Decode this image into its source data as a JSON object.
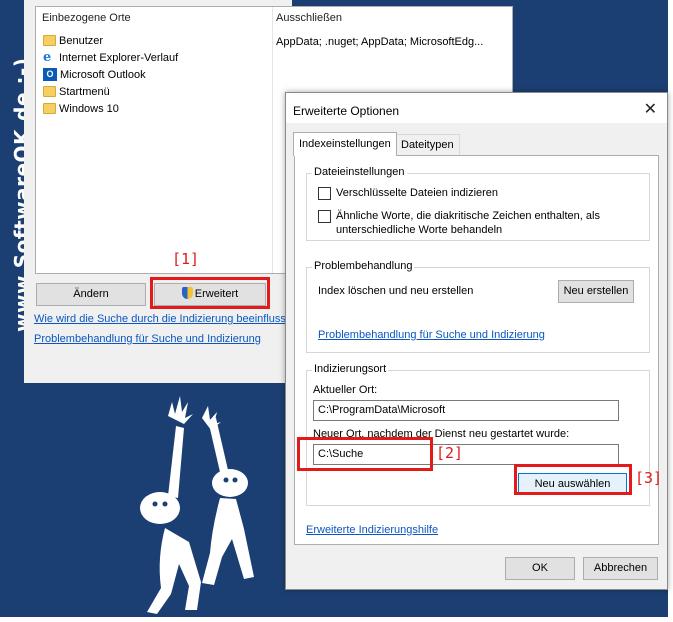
{
  "watermark": "www.SoftwareOK.de :-)",
  "back": {
    "col_locations": "Einbezogene Orte",
    "col_exclude": "Ausschließen",
    "exclude_value": "AppData; .nuget; AppData; MicrosoftEdg...",
    "locations": [
      {
        "icon": "folder-icon",
        "label": "Benutzer"
      },
      {
        "icon": "internet-explorer-icon",
        "label": "Internet Explorer-Verlauf"
      },
      {
        "icon": "outlook-icon",
        "label": "Microsoft Outlook"
      },
      {
        "icon": "folder-icon",
        "label": "Startmenü"
      },
      {
        "icon": "folder-icon",
        "label": "Windows 10"
      }
    ],
    "modify_button": "Ändern",
    "advanced_button": "Erweitert",
    "link_how": "Wie wird die Suche durch die Indizierung beeinflusst?",
    "link_troubleshoot": "Problembehandlung für Suche und Indizierung"
  },
  "markers": {
    "m1": "[1]",
    "m2": "[2]",
    "m3": "[3]"
  },
  "dialog": {
    "title": "Erweiterte Optionen",
    "close": "✕",
    "tabs": [
      "Indexeinstellungen",
      "Dateitypen"
    ],
    "file_settings": {
      "label": "Dateieinstellungen",
      "opt1": "Verschlüsselte Dateien indizieren",
      "opt2_line1": "Ähnliche Worte, die diakritische Zeichen enthalten, als",
      "opt2_line2": "unterschiedliche Worte behandeln"
    },
    "troubleshooting": {
      "label": "Problembehandlung",
      "rebuild_text": "Index löschen und neu erstellen",
      "rebuild_button": "Neu erstellen",
      "link": "Problembehandlung für Suche und Indizierung"
    },
    "index_location": {
      "label": "Indizierungsort",
      "current_label": "Aktueller Ort:",
      "current_value": "C:\\ProgramData\\Microsoft",
      "new_label": "Neuer Ort, nachdem der Dienst neu gestartet wurde:",
      "new_value": "C:\\Suche",
      "select_button": "Neu auswählen"
    },
    "help_link": "Erweiterte Indizierungshilfe",
    "ok": "OK",
    "cancel": "Abbrechen"
  },
  "colors": {
    "highlight": "#e21a1a",
    "link": "#0a56c2",
    "background": "#1c3f73"
  }
}
